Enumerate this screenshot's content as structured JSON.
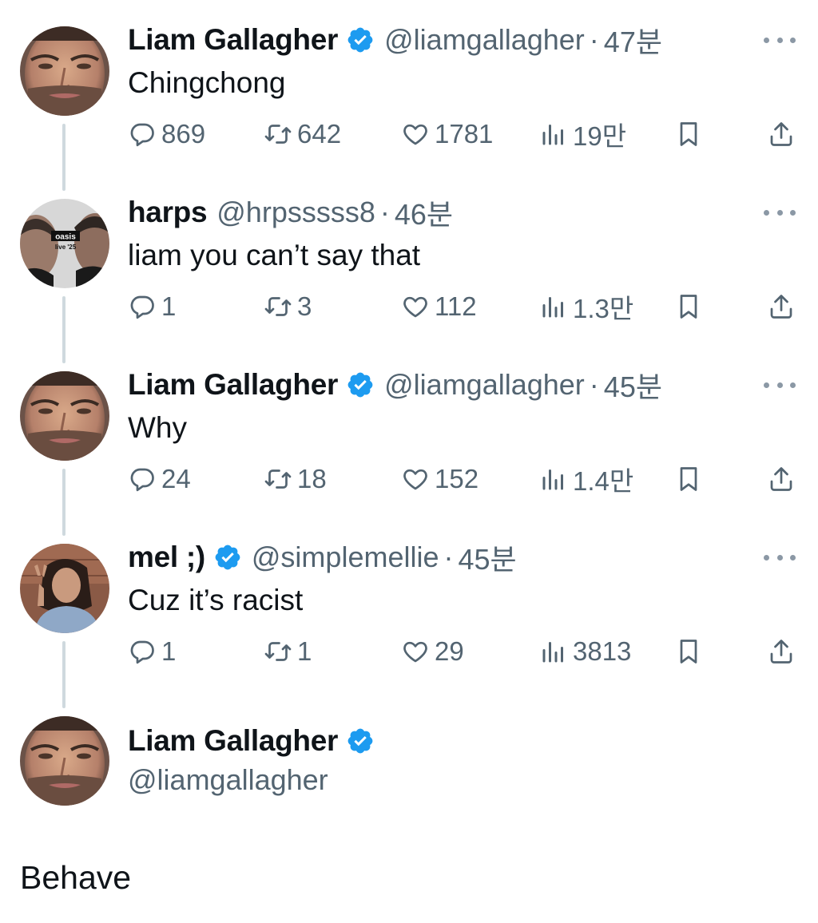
{
  "tweets": [
    {
      "display_name": "Liam Gallagher",
      "verified": true,
      "handle": "@liamgallagher",
      "time": "47분",
      "text": "Chingchong",
      "replies": "869",
      "retweets": "642",
      "likes": "1781",
      "views": "19만",
      "avatar": "liam-photo"
    },
    {
      "display_name": "harps",
      "verified": false,
      "handle": "@hrpsssss8",
      "time": "46분",
      "text": "liam you can’t say that",
      "replies": "1",
      "retweets": "3",
      "likes": "112",
      "views": "1.3만",
      "avatar": "oasis-poster",
      "avatar_label_1": "oasis",
      "avatar_label_2": "live '25"
    },
    {
      "display_name": "Liam Gallagher",
      "verified": true,
      "handle": "@liamgallagher",
      "time": "45분",
      "text": "Why",
      "replies": "24",
      "retweets": "18",
      "likes": "152",
      "views": "1.4만",
      "avatar": "liam-photo"
    },
    {
      "display_name": "mel ;)",
      "verified": true,
      "handle": "@simplemellie",
      "time": "45분",
      "text": "Cuz it’s racist",
      "replies": "1",
      "retweets": "1",
      "likes": "29",
      "views": "3813",
      "avatar": "mel-photo"
    }
  ],
  "main_tweet": {
    "display_name": "Liam Gallagher",
    "verified": true,
    "handle": "@liamgallagher",
    "text": "Behave",
    "avatar": "liam-photo"
  },
  "separator": "·",
  "icons": {
    "reply": "speech-bubble-icon",
    "retweet": "retweet-arrows-icon",
    "like": "heart-icon",
    "views": "bar-chart-icon",
    "bookmark": "bookmark-icon",
    "share": "upload-arrow-icon",
    "verified": "verified-badge-icon",
    "more": "more-dots-icon"
  },
  "colors": {
    "verified_blue": "#1d9bf0",
    "secondary_text": "#536471",
    "primary_text": "#0f1419",
    "thread_line": "#cfd9de"
  }
}
